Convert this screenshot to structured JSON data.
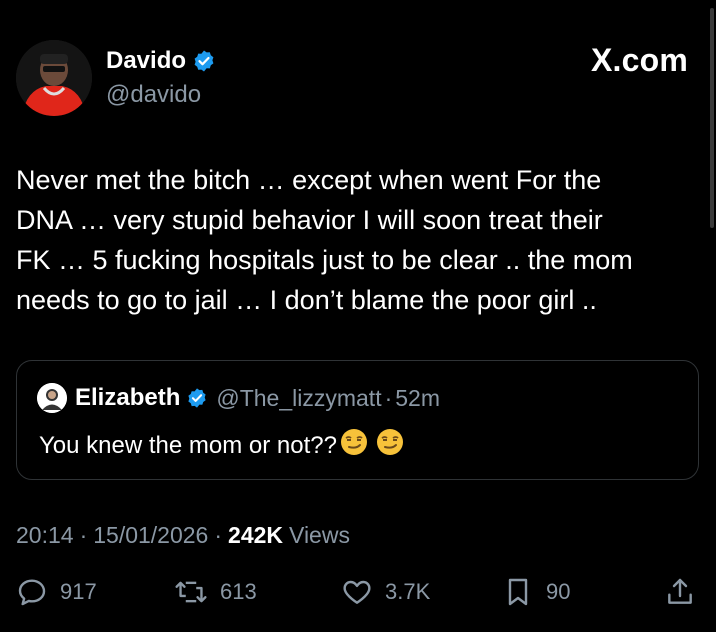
{
  "author": {
    "name": "Davido",
    "handle": "@davido"
  },
  "brand": "X.com",
  "tweet": {
    "text": "Never met the bitch … except when went For the\nDNA … very stupid behavior I will soon treat their\nFK … 5 fucking hospitals just to be clear .. the mom\nneeds to go to jail … I don’t blame the poor girl .."
  },
  "quote": {
    "name": "Elizabeth",
    "handle": "@The_lizzymatt",
    "separator": "·",
    "time": "52m",
    "text": "You knew the mom or not??"
  },
  "meta": {
    "time": "20:14",
    "date": "15/01/2026",
    "views_count": "242K",
    "views_label": "Views",
    "dot": "·"
  },
  "actions": {
    "replies": "917",
    "reposts": "613",
    "likes": "3.7K",
    "bookmarks": "90"
  },
  "colors": {
    "verified": "#1d9bf0",
    "secondary_text": "#8b98a5",
    "border": "#2f3336"
  },
  "icons": [
    "verified-badge-icon",
    "reply-icon",
    "repost-icon",
    "like-icon",
    "bookmark-icon",
    "share-icon"
  ]
}
